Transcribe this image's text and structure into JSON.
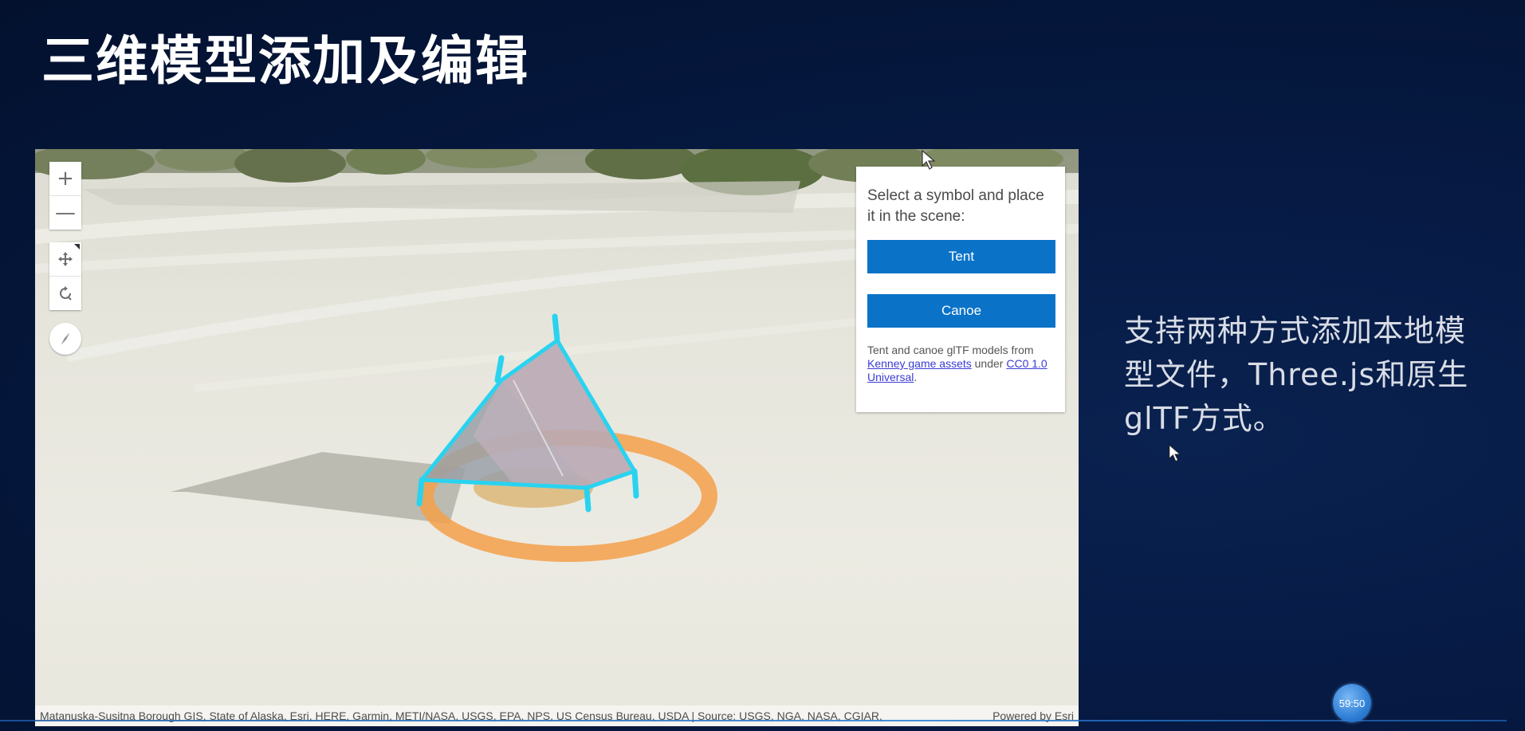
{
  "slide": {
    "title": "三维模型添加及编辑",
    "description": "支持两种方式添加本地模型文件，Three.js和原生glTF方式。"
  },
  "map_controls": {
    "zoom_in": "+",
    "zoom_out": "—",
    "pan_icon": "move-icon",
    "rotate_icon": "rotate-icon",
    "compass_icon": "compass-icon"
  },
  "symbol_panel": {
    "instructions": "Select a symbol and place it in the scene:",
    "buttons": [
      "Tent",
      "Canoe"
    ],
    "credit_prefix": "Tent and canoe glTF models from ",
    "credit_link1": "Kenney game assets",
    "credit_middle": " under ",
    "credit_link2": "CC0 1.0 Universal",
    "credit_suffix": "."
  },
  "attribution": {
    "sources": "Matanuska-Susitna Borough GIS, State of Alaska, Esri, HERE, Garmin, METI/NASA, USGS, EPA, NPS, US Census Bureau, USDA | Source: USGS, NGA, NASA, CGIAR,",
    "powered_by": "Powered by Esri"
  },
  "playback": {
    "timer": "59:50"
  },
  "colors": {
    "background": "#04163a",
    "button_blue": "#0a73c8",
    "selection_cyan": "#29d3f0",
    "ring_orange": "#f5a04a"
  }
}
